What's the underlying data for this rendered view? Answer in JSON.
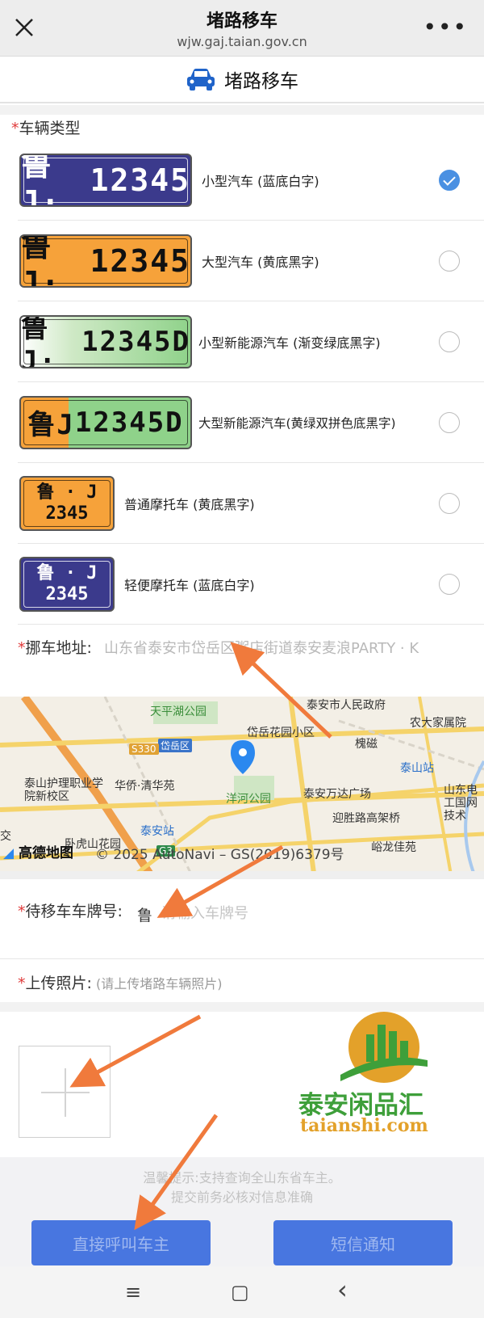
{
  "browser": {
    "title": "堵路移车",
    "url": "wjw.gaj.taian.gov.cn"
  },
  "header": {
    "title": "堵路移车"
  },
  "vehicle_type": {
    "required_mark": "*",
    "label": "车辆类型",
    "options": [
      {
        "label": "小型汽车 (蓝底白字)",
        "plate_prefix": "鲁J·",
        "plate_number": "12345",
        "checked": true
      },
      {
        "label": "大型汽车 (黄底黑字)",
        "plate_prefix": "鲁J·",
        "plate_number": "12345",
        "checked": false
      },
      {
        "label": "小型新能源汽车 (渐变绿底黑字)",
        "plate_prefix": "鲁J·",
        "plate_number": "12345D",
        "checked": false
      },
      {
        "label": "大型新能源汽车(黄绿双拼色底黑字)",
        "plate_prefix": "鲁J",
        "plate_number": "12345D",
        "checked": false
      },
      {
        "label": "普通摩托车 (黄底黑字)",
        "plate_top": "鲁 · J",
        "plate_bottom": "2345",
        "checked": false
      },
      {
        "label": "轻便摩托车 (蓝底白字)",
        "plate_top": "鲁 · J",
        "plate_bottom": "2345",
        "checked": false
      }
    ]
  },
  "address": {
    "required_mark": "*",
    "label": "挪车地址:",
    "value": "山东省泰安市岱岳区粥店街道泰安麦浪PARTY · K"
  },
  "map": {
    "labels": [
      "天平湖公园",
      "泰安市人民政府",
      "农大家属院",
      "岱岳花园小区",
      "槐磁",
      "泰山站",
      "岱岳区",
      "S330",
      "泰山护理职业学院新校区",
      "华侨·清华苑",
      "洋河公园",
      "泰安万达广场",
      "山东电工国网技术",
      "泰安站",
      "迎胜路高架桥",
      "卧虎山花园",
      "G3",
      "峪龙佳苑",
      "交"
    ],
    "logo": "高德地图",
    "copyright": "© 2025 AutoNavi – GS(2019)6379号"
  },
  "plate_field": {
    "required_mark": "*",
    "label": "待移车车牌号:",
    "prefix": "鲁",
    "placeholder": "请输入车牌号"
  },
  "photo": {
    "required_mark": "*",
    "label": "上传照片:",
    "hint": "(请上传堵路车辆照片)"
  },
  "watermark": {
    "title": "泰安闲品汇",
    "domain": "taianshi.com"
  },
  "tips": {
    "line1": "温馨提示:支持查询全山东省车主。",
    "line2": "提交前务必核对信息准确"
  },
  "buttons": {
    "call": "直接呼叫车主",
    "sms": "短信通知"
  },
  "navbar": {
    "menu": "≡",
    "home": "▢",
    "back": "‹"
  },
  "colors": {
    "accent": "#4876e0",
    "radio_checked": "#4a90e2",
    "required": "#e03b3b",
    "arrow": "#f07a3c"
  }
}
